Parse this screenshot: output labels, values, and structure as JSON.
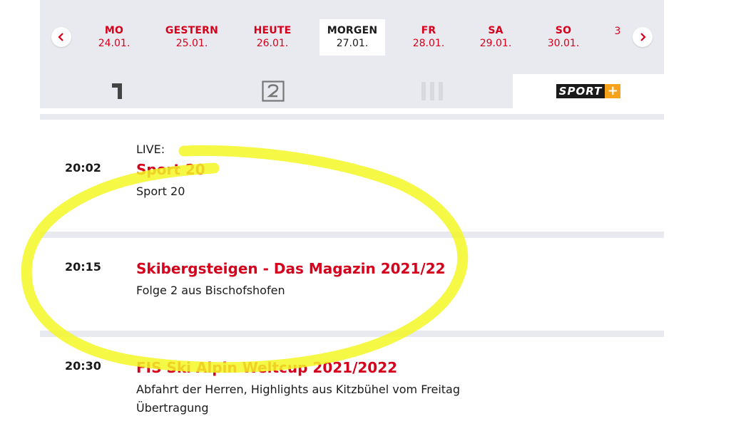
{
  "date_nav": {
    "prev_label": "‹",
    "next_label": "›",
    "days": [
      {
        "name": "MO",
        "date": "24.01."
      },
      {
        "name": "GESTERN",
        "date": "25.01."
      },
      {
        "name": "HEUTE",
        "date": "26.01."
      },
      {
        "name": "MORGEN",
        "date": "27.01.",
        "active": true
      },
      {
        "name": "FR",
        "date": "28.01."
      },
      {
        "name": "SA",
        "date": "29.01."
      },
      {
        "name": "SO",
        "date": "30.01."
      },
      {
        "name": "",
        "date": "3"
      }
    ]
  },
  "channels": {
    "items": [
      {
        "icon": "orf1-logo-icon"
      },
      {
        "icon": "orf2-logo-icon"
      },
      {
        "icon": "orf3-logo-icon"
      },
      {
        "icon": "sport-plus-logo-icon",
        "word": "SPORT",
        "plus": "+",
        "active": true
      }
    ]
  },
  "programs": [
    {
      "time": "20:02",
      "label": "LIVE:",
      "title": "Sport 20",
      "subtitle": "Sport 20"
    },
    {
      "time": "20:15",
      "title": "Skibergsteigen - Das Magazin 2021/22",
      "subtitle": "Folge 2 aus Bischofshofen"
    },
    {
      "time": "20:30",
      "title": "FIS Ski Alpin Weltcup 2021/2022",
      "subtitle": "Abfahrt der Herren, Highlights aus Kitzbühel vom Freitag",
      "subtitle2": "Übertragung"
    }
  ],
  "colors": {
    "accent_red": "#d5001c",
    "sport_plus_orange": "#f7a21b",
    "highlight_yellow": "#f3f724",
    "background_gray": "#e9eaef"
  }
}
